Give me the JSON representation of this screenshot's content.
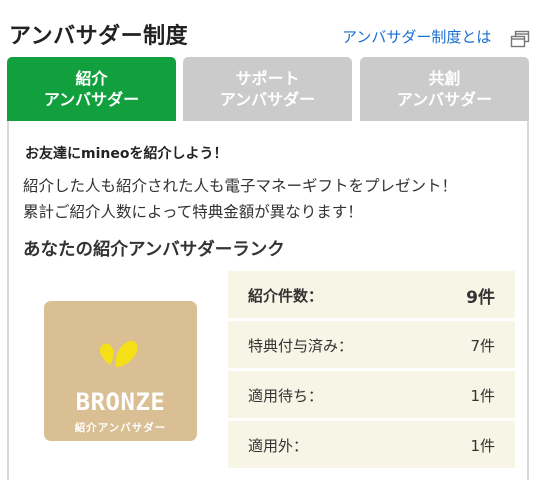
{
  "header": {
    "title": "アンバサダー制度",
    "about_link": "アンバサダー制度とは",
    "external_icon": "external-window-icon"
  },
  "tabs": [
    {
      "label": "紹介\nアンバサダー",
      "active": true
    },
    {
      "label": "サポート\nアンバサダー",
      "active": false
    },
    {
      "label": "共創\nアンバサダー",
      "active": false
    }
  ],
  "intro": {
    "heading": "お友達にmineoを紹介しよう！",
    "line1": "紹介した人も紹介された人も電子マネーギフトをプレゼント！",
    "line2": "累計ご紹介人数によって特典金額が異なります！"
  },
  "rank": {
    "heading": "あなたの紹介アンバサダーランク",
    "badge_rank": "BRONZE",
    "badge_sub": "紹介アンバサダー",
    "badge_color": "#d9bf93",
    "logo_color": "#f5e017"
  },
  "stats": [
    {
      "label": "紹介件数：",
      "value": "9件"
    },
    {
      "label": "特典付与済み：",
      "value": "7件"
    },
    {
      "label": "適用待ち：",
      "value": "1件"
    },
    {
      "label": "適用外：",
      "value": "1件"
    }
  ],
  "colors": {
    "active_tab": "#11a03d",
    "inactive_tab": "#cbcbcb",
    "link": "#1a6fd1"
  }
}
